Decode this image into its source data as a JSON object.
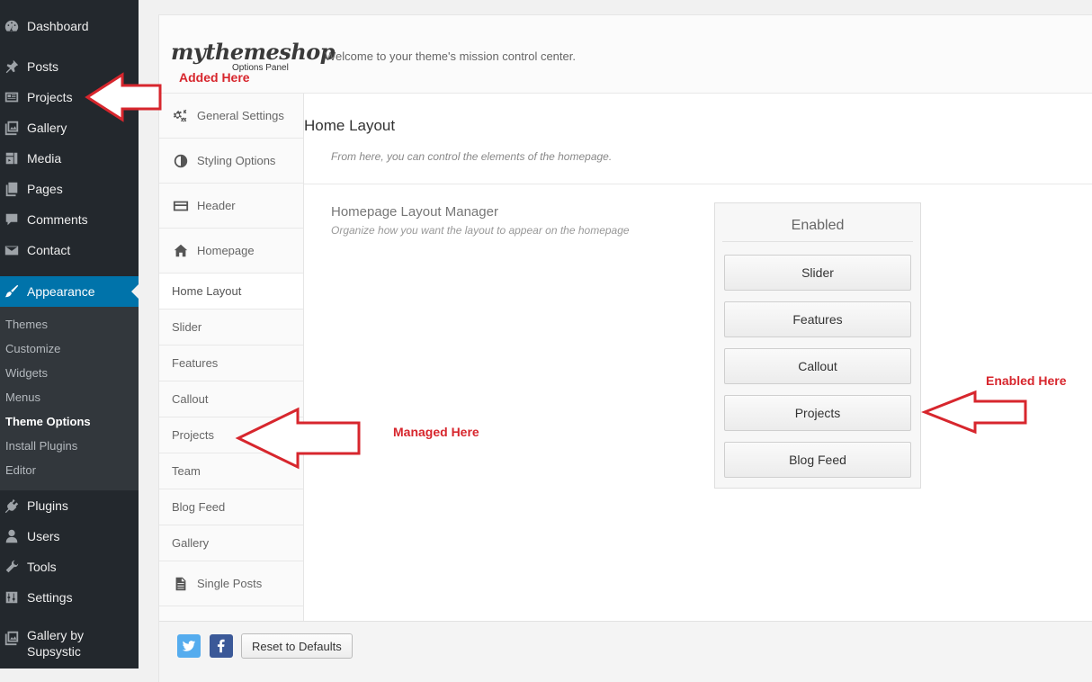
{
  "wp_menu": {
    "dashboard": "Dashboard",
    "posts": "Posts",
    "projects": "Projects",
    "gallery": "Gallery",
    "media": "Media",
    "pages": "Pages",
    "comments": "Comments",
    "contact": "Contact",
    "appearance": "Appearance",
    "appearance_sub": [
      "Themes",
      "Customize",
      "Widgets",
      "Menus",
      "Theme Options",
      "Install Plugins",
      "Editor"
    ],
    "plugins": "Plugins",
    "users": "Users",
    "tools": "Tools",
    "settings": "Settings",
    "gallery_supsystic": [
      "Gallery by",
      "Supsystic"
    ]
  },
  "panel": {
    "logo": "mythemeshop",
    "logo_sub": "Options Panel",
    "welcome": "Welcome to your theme's mission control center.",
    "nav": {
      "general": "General Settings",
      "styling": "Styling Options",
      "header": "Header",
      "homepage": "Homepage",
      "sub": [
        "Home Layout",
        "Slider",
        "Features",
        "Callout",
        "Projects",
        "Team",
        "Blog Feed",
        "Gallery"
      ],
      "single_posts": "Single Posts"
    },
    "section_title": "Home Layout",
    "section_desc": "From here, you can control the elements of the homepage.",
    "field_label": "Homepage Layout Manager",
    "field_desc": "Organize how you want the layout to appear on the homepage",
    "enabled_title": "Enabled",
    "enabled_blocks": [
      "Slider",
      "Features",
      "Callout",
      "Projects",
      "Blog Feed"
    ],
    "reset_label": "Reset to Defaults"
  },
  "annotations": {
    "added": "Added Here",
    "managed": "Managed Here",
    "enabled": "Enabled Here",
    "color": "#d7262d"
  }
}
